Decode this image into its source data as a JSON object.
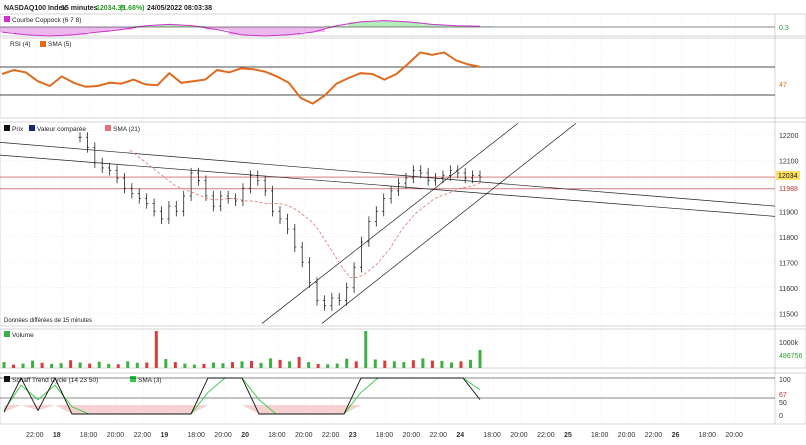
{
  "header": {
    "symbol": "NASDAQ100 Index",
    "interval": "15 minutes",
    "price": "12034.39",
    "change": "(1.68%)",
    "datetime": "24/05/2022 08:03:38",
    "price_color": "#2ca02c"
  },
  "colors": {
    "grid": "#d8d8d8",
    "axis_text": "#333333",
    "price_line": "#c03030",
    "channel": "#222222",
    "rsi_line": "#e06a1e",
    "coppock_pos": "#2ecc40",
    "coppock_neg": "#cc33cc",
    "volume_up": "#3cb043",
    "volume_down": "#d93a3a",
    "schaff": "#111111",
    "schaff_sma": "#2ecc40",
    "schaff_fill": "#f4c5c5",
    "badge_last": "#ffe066",
    "badge_red": "#c03030"
  },
  "panels": {
    "coppock": {
      "legend": "Courbe Coppock (6 7 8)",
      "value_label": "0.3"
    },
    "rsi": {
      "legend_main": "RSI (4)",
      "legend_sma": "SMA (5)",
      "value_label": "47"
    },
    "main": {
      "legend_price": "Prix",
      "legend_compare": "Valeur comparée",
      "legend_sma": "SMA (21)",
      "footnote": "Données différées de 15 minutes",
      "last_price_label": "12034",
      "ref_price_label": "11988",
      "y_ticks": [
        "12200",
        "12100",
        "11900",
        "11800",
        "11700",
        "11600",
        "11500"
      ]
    },
    "volume": {
      "legend": "Volume",
      "y_top": "1000k",
      "value_label": "486756"
    },
    "schaff": {
      "legend": "Schaff Trend Cycle (14 23 50)",
      "legend_sma": "SMA (3)",
      "y_top": "100",
      "y_mid": "50",
      "value_label": "67",
      "y_bottom": "0"
    }
  },
  "x_axis": {
    "labels": [
      {
        "text": "22:00",
        "bold": false
      },
      {
        "text": "18",
        "bold": true
      },
      {
        "text": "18:00",
        "bold": false
      },
      {
        "text": "20:00",
        "bold": false
      },
      {
        "text": "22:00",
        "bold": false
      },
      {
        "text": "19",
        "bold": true
      },
      {
        "text": "18:00",
        "bold": false
      },
      {
        "text": "20:00",
        "bold": false
      },
      {
        "text": "20",
        "bold": true
      },
      {
        "text": "18:00",
        "bold": false
      },
      {
        "text": "20:00",
        "bold": false
      },
      {
        "text": "22:00",
        "bold": false
      },
      {
        "text": "23",
        "bold": true
      },
      {
        "text": "18:00",
        "bold": false
      },
      {
        "text": "20:00",
        "bold": false
      },
      {
        "text": "22:00",
        "bold": false
      },
      {
        "text": "24",
        "bold": true
      },
      {
        "text": "18:00",
        "bold": false
      },
      {
        "text": "20:00",
        "bold": false
      },
      {
        "text": "22:00",
        "bold": false
      },
      {
        "text": "25",
        "bold": true
      },
      {
        "text": "18:00",
        "bold": false
      },
      {
        "text": "20:00",
        "bold": false
      },
      {
        "text": "22:00",
        "bold": false
      },
      {
        "text": "26",
        "bold": true
      },
      {
        "text": "18:00",
        "bold": false
      },
      {
        "text": "20:00",
        "bold": false
      }
    ]
  },
  "chart_data": {
    "type": "line",
    "title": "NASDAQ100 Index",
    "price_series": [
      12190,
      12150,
      12090,
      12070,
      12060,
      12030,
      11990,
      11970,
      11950,
      11930,
      11900,
      11870,
      11920,
      11900,
      11960,
      12050,
      12020,
      11960,
      11920,
      11960,
      11950,
      11940,
      11990,
      12040,
      12020,
      11980,
      11900,
      11870,
      11830,
      11760,
      11700,
      11620,
      11550,
      11530,
      11560,
      11550,
      11600,
      11680,
      11780,
      11860,
      11900,
      11950,
      11980,
      12010,
      12030,
      12060,
      12050,
      12020,
      12030,
      12040,
      12060,
      12050,
      12030,
      12040,
      12034
    ],
    "sma21": [
      12140,
      12120,
      12100,
      12080,
      12060,
      12040,
      12020,
      12000,
      11990,
      11980,
      11970,
      11960,
      11950,
      11945,
      11945,
      11950,
      11950,
      11945,
      11940,
      11940,
      11935,
      11930,
      11930,
      11930,
      11925,
      11915,
      11900,
      11880,
      11860,
      11830,
      11790,
      11750,
      11710,
      11670,
      11640,
      11640,
      11650,
      11670,
      11690,
      11720,
      11750,
      11790,
      11830,
      11860,
      11890,
      11910,
      11930,
      11950,
      11960,
      11970,
      11980,
      11990,
      11995,
      12000,
      12010
    ],
    "price_ylim": [
      11450,
      12250
    ],
    "ref_lines": [
      12034,
      11988
    ],
    "rsi": [
      55,
      60,
      57,
      46,
      40,
      52,
      44,
      39,
      40,
      44,
      43,
      48,
      42,
      41,
      56,
      44,
      46,
      48,
      60,
      57,
      62,
      61,
      58,
      52,
      44,
      25,
      18,
      28,
      43,
      50,
      56,
      55,
      48,
      55,
      68,
      82,
      79,
      82,
      72,
      67,
      64
    ],
    "rsi_sma_value": 47,
    "coppock": [
      -2,
      -3,
      -3.5,
      -3,
      -2,
      -1,
      0.5,
      1,
      0.5,
      -1,
      -3,
      -3.5,
      -3,
      -2,
      0.5,
      2,
      2.5,
      2,
      1,
      0.5,
      0.3
    ],
    "volume_k": [
      160,
      90,
      120,
      200,
      140,
      110,
      130,
      210,
      150,
      120,
      170,
      110,
      100,
      180,
      140,
      150,
      1000,
      240,
      160,
      120,
      90,
      110,
      150,
      130,
      160,
      180,
      190,
      140,
      260,
      220,
      180,
      300,
      160,
      110,
      100,
      120,
      250,
      180,
      1000,
      230,
      200,
      180,
      160,
      210,
      260,
      200,
      190,
      150,
      180,
      220,
      486.756
    ],
    "volume_up": [
      true,
      false,
      true,
      true,
      false,
      true,
      true,
      false,
      true,
      false,
      true,
      true,
      false,
      true,
      true,
      false,
      false,
      true,
      false,
      true,
      true,
      false,
      true,
      true,
      false,
      true,
      false,
      true,
      true,
      false,
      true,
      false,
      true,
      false,
      true,
      true,
      true,
      false,
      true,
      true,
      false,
      true,
      true,
      false,
      true,
      false,
      true,
      true,
      false,
      true,
      true
    ],
    "schaff": [
      5,
      100,
      10,
      100,
      0,
      0,
      0,
      0,
      0,
      0,
      0,
      0,
      100,
      100,
      100,
      0,
      0,
      0,
      0,
      0,
      0,
      100,
      100,
      100,
      100,
      100,
      100,
      100,
      40
    ],
    "schaff_sma": [
      10,
      80,
      40,
      80,
      20,
      0,
      0,
      0,
      0,
      0,
      0,
      0,
      60,
      100,
      100,
      40,
      0,
      0,
      0,
      0,
      0,
      60,
      100,
      100,
      100,
      100,
      100,
      100,
      67
    ],
    "schaff_ylim": [
      0,
      100
    ]
  }
}
